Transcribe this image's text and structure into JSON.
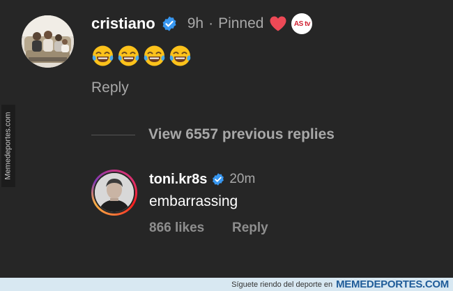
{
  "watermark": {
    "side_text": "Memedeportes.com",
    "bottom_text": "Síguete riendo del deporte en",
    "bottom_brand": "MEMEDEPORTES.COM"
  },
  "main_comment": {
    "username": "cristiano",
    "time": "9h",
    "separator": "·",
    "pinned_label": "Pinned",
    "badge_text": "AS tv",
    "emojis": [
      "😂",
      "😂",
      "😂",
      "😂"
    ],
    "reply_label": "Reply"
  },
  "thread": {
    "view_replies": "View 6557 previous replies"
  },
  "reply_comment": {
    "username": "toni.kr8s",
    "time": "20m",
    "text": "embarrassing",
    "likes": "866 likes",
    "reply_label": "Reply"
  },
  "colors": {
    "background": "#262626",
    "verified_blue": "#3897f0",
    "secondary_text": "#a8a8a8",
    "heart_red": "#ed4956"
  }
}
